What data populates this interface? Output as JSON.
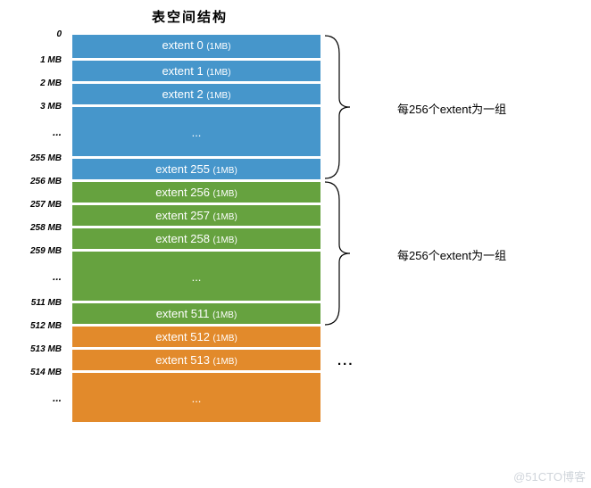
{
  "title": "表空间结构",
  "labels": {
    "l0": "0",
    "l1": "1 MB",
    "l2": "2 MB",
    "l3": "3 MB",
    "l_ell1": "...",
    "l255": "255 MB",
    "l256": "256 MB",
    "l257": "257 MB",
    "l258": "258 MB",
    "l259": "259 MB",
    "l_ell2": "...",
    "l511": "511 MB",
    "l512": "512 MB",
    "l513": "513 MB",
    "l514": "514 MB",
    "l_ell3": "..."
  },
  "extents": {
    "e0": {
      "name": "extent 0",
      "size": "(1MB)"
    },
    "e1": {
      "name": "extent 1",
      "size": "(1MB)"
    },
    "e2": {
      "name": "extent 2",
      "size": "(1MB)"
    },
    "ell1": "...",
    "e255": {
      "name": "extent 255",
      "size": "(1MB)"
    },
    "e256": {
      "name": "extent 256",
      "size": "(1MB)"
    },
    "e257": {
      "name": "extent 257",
      "size": "(1MB)"
    },
    "e258": {
      "name": "extent 258",
      "size": "(1MB)"
    },
    "ell2": "...",
    "e511": {
      "name": "extent 511",
      "size": "(1MB)"
    },
    "e512": {
      "name": "extent 512",
      "size": "(1MB)"
    },
    "e513": {
      "name": "extent 513",
      "size": "(1MB)"
    },
    "ell3": "..."
  },
  "annotations": {
    "group1": "每256个extent为一组",
    "group2": "每256个extent为一组",
    "side_ellipsis": "..."
  },
  "watermark": "@51CTO博客"
}
